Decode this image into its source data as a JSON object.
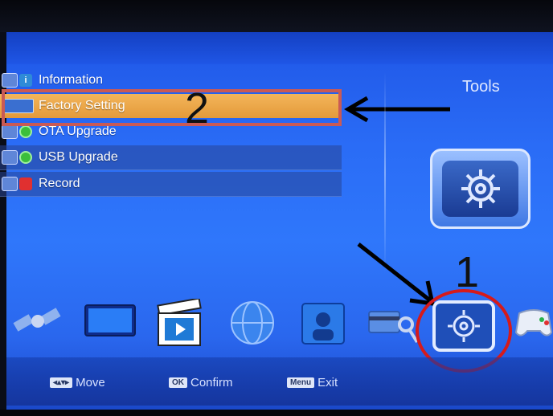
{
  "menu": {
    "items": [
      {
        "label": "Information",
        "state": "normal"
      },
      {
        "label": "Factory Setting",
        "state": "selected"
      },
      {
        "label": "OTA Upgrade",
        "state": "normal"
      },
      {
        "label": "USB Upgrade",
        "state": "dim"
      },
      {
        "label": "Record",
        "state": "dim"
      }
    ]
  },
  "panel": {
    "title": "Tools",
    "icon": "gear-icon"
  },
  "annotations": {
    "step1": "1",
    "step2": "2"
  },
  "categories": [
    {
      "name": "satellite-icon"
    },
    {
      "name": "tv-icon"
    },
    {
      "name": "clapperboard-icon"
    },
    {
      "name": "globe-icon"
    },
    {
      "name": "people-icon"
    },
    {
      "name": "key-card-icon"
    },
    {
      "name": "tools-gear-icon",
      "selected": true
    },
    {
      "name": "gamepad-icon"
    }
  ],
  "hints": {
    "move_key": "",
    "move": "Move",
    "ok_key": "OK",
    "confirm": "Confirm",
    "menu_key": "Menu",
    "exit": "Exit"
  },
  "colors": {
    "selected": "#e9a44a",
    "annotation_red": "#d61a1a"
  }
}
